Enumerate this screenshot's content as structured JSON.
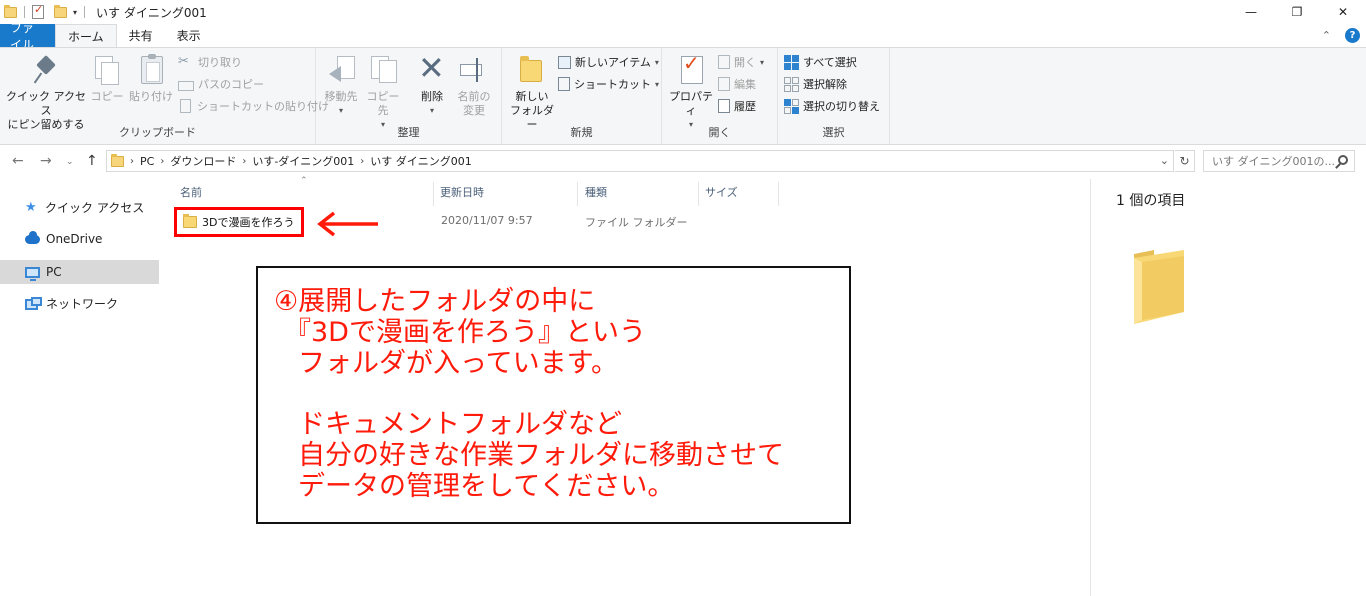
{
  "window": {
    "title": "いす ダイニング001",
    "controls": {
      "minimize": "—",
      "maximize": "❐",
      "close": "✕"
    }
  },
  "quick_access_toolbar": {
    "dropdown": "▾"
  },
  "tabs": {
    "file": "ファイル",
    "home": "ホーム",
    "share": "共有",
    "view": "表示",
    "help": "?"
  },
  "ribbon": {
    "clipboard": {
      "label": "クリップボード",
      "pin_line1": "クイック アクセス",
      "pin_line2": "にピン留めする",
      "copy": "コピー",
      "paste": "貼り付け",
      "cut": "切り取り",
      "copy_path": "パスのコピー",
      "paste_shortcut": "ショートカットの貼り付け"
    },
    "organize": {
      "label": "整理",
      "move_to": "移動先",
      "copy_to": "コピー先",
      "delete": "削除",
      "rename_line1": "名前の",
      "rename_line2": "変更"
    },
    "new": {
      "label": "新規",
      "new_folder_line1": "新しい",
      "new_folder_line2": "フォルダー",
      "new_item": "新しいアイテム",
      "shortcut": "ショートカット"
    },
    "open": {
      "label": "開く",
      "properties": "プロパティ",
      "open": "開く",
      "edit": "編集",
      "history": "履歴"
    },
    "select": {
      "label": "選択",
      "select_all": "すべて選択",
      "select_none": "選択解除",
      "invert": "選択の切り替え"
    }
  },
  "address_bar": {
    "crumbs": [
      "PC",
      "ダウンロード",
      "いす-ダイニング001",
      "いす ダイニング001"
    ],
    "search_placeholder": "いす ダイニング001の..."
  },
  "sidebar": {
    "items": [
      {
        "label": "クイック アクセス",
        "icon": "star-icon"
      },
      {
        "label": "OneDrive",
        "icon": "cloud-icon"
      },
      {
        "label": "PC",
        "icon": "computer-icon",
        "selected": true
      },
      {
        "label": "ネットワーク",
        "icon": "network-icon"
      }
    ]
  },
  "file_list": {
    "columns": [
      "名前",
      "更新日時",
      "種類",
      "サイズ"
    ],
    "rows": [
      {
        "name": "3Dで漫画を作ろう",
        "modified": "2020/11/07 9:57",
        "type": "ファイル フォルダー",
        "size": ""
      }
    ]
  },
  "details_pane": {
    "count": "1 個の項目"
  },
  "annotation": {
    "color": "#ff1a0a",
    "lines": [
      "④展開したフォルダの中に",
      "『3Dで漫画を作ろう』という",
      "フォルダが入っています。",
      "ドキュメントフォルダなど",
      "自分の好きな作業フォルダに移動させて",
      "データの管理をしてください。"
    ]
  }
}
